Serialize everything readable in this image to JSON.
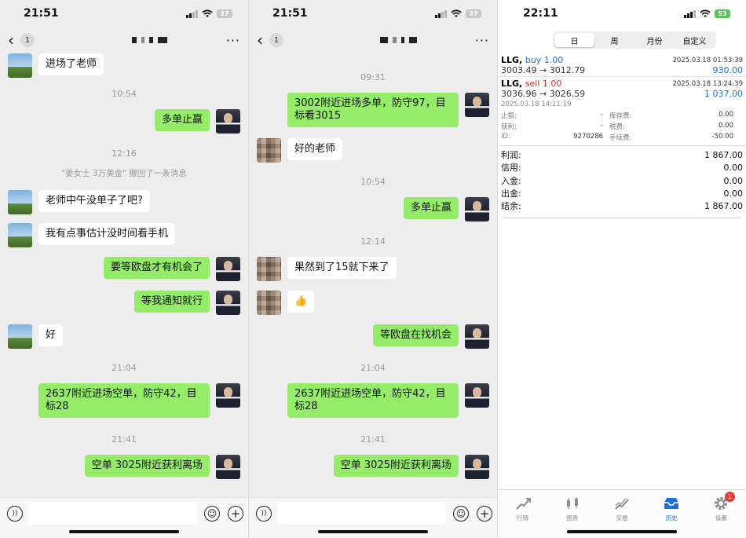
{
  "panel1": {
    "status": {
      "time": "21:51",
      "battery": "37"
    },
    "unread": "1",
    "messages": [
      {
        "type": "in",
        "text": "进场了老师"
      },
      {
        "type": "time",
        "text": "10:54"
      },
      {
        "type": "out",
        "text": "多单止赢"
      },
      {
        "type": "time",
        "text": "12:16"
      },
      {
        "type": "system",
        "text": "\"姜女士 3万美金\" 撤回了一条消息"
      },
      {
        "type": "in",
        "text": "老师中午没单子了吧?"
      },
      {
        "type": "in",
        "text": "我有点事估计没时间看手机"
      },
      {
        "type": "out",
        "text": "要等欧盘才有机会了"
      },
      {
        "type": "out",
        "text": "等我通知就行"
      },
      {
        "type": "in",
        "text": "好"
      },
      {
        "type": "time",
        "text": "21:04"
      },
      {
        "type": "out",
        "text": "2637附近进场空单，防守42，目标28"
      },
      {
        "type": "time",
        "text": "21:41"
      },
      {
        "type": "out",
        "text": "空单 3025附近获利离场"
      }
    ]
  },
  "panel2": {
    "status": {
      "time": "21:51",
      "battery": "37"
    },
    "unread": "1",
    "messages": [
      {
        "type": "time",
        "text": "09:31"
      },
      {
        "type": "out",
        "text": "3002附近进场多单，防守97，目标看3015"
      },
      {
        "type": "in",
        "text": "好的老师"
      },
      {
        "type": "time",
        "text": "10:54"
      },
      {
        "type": "out",
        "text": "多单止赢"
      },
      {
        "type": "time",
        "text": "12:14"
      },
      {
        "type": "in",
        "text": "果然到了15就下来了"
      },
      {
        "type": "in",
        "text": "👍"
      },
      {
        "type": "out",
        "text": "等欧盘在找机会"
      },
      {
        "type": "time",
        "text": "21:04"
      },
      {
        "type": "out",
        "text": "2637附近进场空单，防守42，目标28"
      },
      {
        "type": "time",
        "text": "21:41"
      },
      {
        "type": "out",
        "text": "空单 3025附近获利离场"
      }
    ]
  },
  "panel3": {
    "status": {
      "time": "22:11",
      "battery": "53"
    },
    "segments": [
      "日",
      "周",
      "月份",
      "自定义"
    ],
    "active_segment": 0,
    "deals": [
      {
        "symbol": "LLG,",
        "side": "buy 1.00",
        "side_color": "#1e6fd9",
        "datetime": "2025.03.18 01:53:39",
        "prices": "3003.49 → 3012.79",
        "profit": "930.00",
        "profit_color": "#1e6fd9"
      },
      {
        "symbol": "LLG,",
        "side": "sell 1.00",
        "side_color": "#d93025",
        "datetime": "2025.03.18 13:24:39",
        "prices": "3036.96 → 3026.59",
        "profit": "1 037.00",
        "profit_color": "#1e6fd9"
      }
    ],
    "detail": {
      "open_time": "2025.03.18 14:11:19",
      "left": [
        {
          "k": "止损:",
          "v": "-"
        },
        {
          "k": "获利:",
          "v": "-"
        },
        {
          "k": "ID:",
          "v": "9270286"
        }
      ],
      "right": [
        {
          "k": "库存费:",
          "v": "0.00"
        },
        {
          "k": "税费:",
          "v": "0.00"
        },
        {
          "k": "手续费:",
          "v": "-50.00"
        }
      ]
    },
    "summary": [
      {
        "k": "利润:",
        "v": "1 867.00"
      },
      {
        "k": "信用:",
        "v": "0.00"
      },
      {
        "k": "入金:",
        "v": "0.00"
      },
      {
        "k": "出金:",
        "v": "0.00"
      },
      {
        "k": "结余:",
        "v": "1 867.00"
      }
    ],
    "tabs": [
      {
        "label": "行情",
        "icon": "quotes-icon"
      },
      {
        "label": "图表",
        "icon": "chart-icon"
      },
      {
        "label": "交易",
        "icon": "trade-icon"
      },
      {
        "label": "历史",
        "icon": "history-icon"
      },
      {
        "label": "设置",
        "icon": "settings-icon"
      }
    ],
    "active_tab": 3,
    "settings_badge": "1"
  }
}
